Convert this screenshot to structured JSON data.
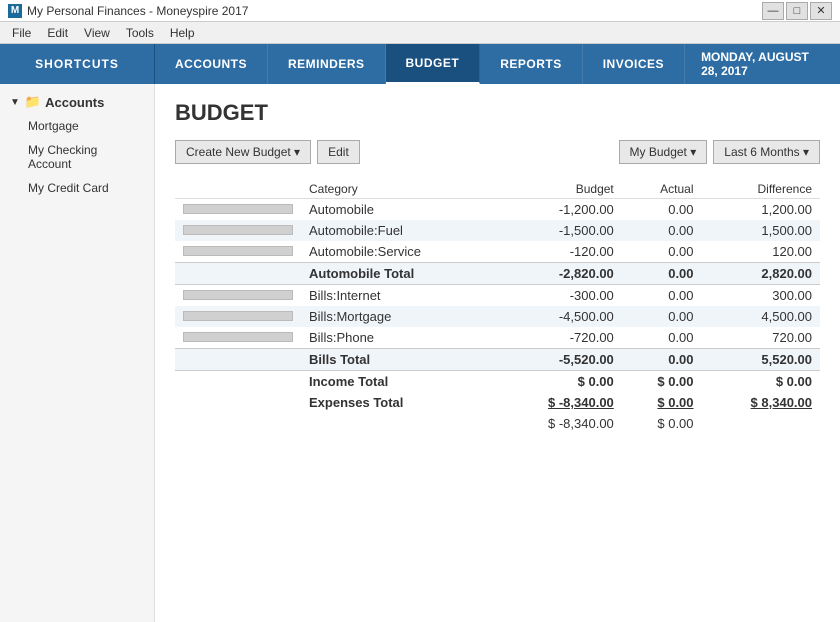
{
  "titlebar": {
    "icon": "M",
    "title": "My Personal Finances - Moneyspire 2017",
    "min_btn": "—",
    "max_btn": "□",
    "close_btn": "✕"
  },
  "menubar": {
    "items": [
      "File",
      "Edit",
      "View",
      "Tools",
      "Help"
    ]
  },
  "topnav": {
    "shortcuts_label": "SHORTCUTS",
    "tabs": [
      {
        "label": "ACCOUNTS",
        "active": false
      },
      {
        "label": "REMINDERS",
        "active": false
      },
      {
        "label": "BUDGET",
        "active": true
      },
      {
        "label": "REPORTS",
        "active": false
      },
      {
        "label": "INVOICES",
        "active": false
      }
    ],
    "date": "MONDAY, AUGUST 28, 2017"
  },
  "sidebar": {
    "accounts_label": "Accounts",
    "accounts": [
      {
        "name": "Mortgage"
      },
      {
        "name": "My Checking Account"
      },
      {
        "name": "My Credit Card"
      }
    ]
  },
  "content": {
    "page_title": "BUDGET",
    "toolbar": {
      "create_btn": "Create New Budget ▾",
      "edit_btn": "Edit",
      "budget_selector": "My Budget ▾",
      "period_selector": "Last 6 Months ▾"
    },
    "table": {
      "headers": {
        "category": "Category",
        "budget": "Budget",
        "actual": "Actual",
        "difference": "Difference"
      },
      "rows": [
        {
          "type": "item",
          "category": "Automobile",
          "budget": "-1,200.00",
          "actual": "0.00",
          "difference": "1,200.00",
          "diff_color": "green",
          "striped": false
        },
        {
          "type": "item",
          "category": "Automobile:Fuel",
          "budget": "-1,500.00",
          "actual": "0.00",
          "difference": "1,500.00",
          "diff_color": "green",
          "striped": true
        },
        {
          "type": "item",
          "category": "Automobile:Service",
          "budget": "-120.00",
          "actual": "0.00",
          "difference": "120.00",
          "diff_color": "green",
          "striped": false
        },
        {
          "type": "total",
          "category": "Automobile Total",
          "budget": "-2,820.00",
          "actual": "0.00",
          "difference": "2,820.00",
          "diff_color": "green",
          "striped": true
        },
        {
          "type": "item",
          "category": "Bills:Internet",
          "budget": "-300.00",
          "actual": "0.00",
          "difference": "300.00",
          "diff_color": "green",
          "striped": false
        },
        {
          "type": "item",
          "category": "Bills:Mortgage",
          "budget": "-4,500.00",
          "actual": "0.00",
          "difference": "4,500.00",
          "diff_color": "green",
          "striped": true
        },
        {
          "type": "item",
          "category": "Bills:Phone",
          "budget": "-720.00",
          "actual": "0.00",
          "difference": "720.00",
          "diff_color": "green",
          "striped": false
        },
        {
          "type": "total",
          "category": "Bills Total",
          "budget": "-5,520.00",
          "actual": "0.00",
          "difference": "5,520.00",
          "diff_color": "green",
          "striped": true
        },
        {
          "type": "grand",
          "category": "Income Total",
          "budget": "$ 0.00",
          "actual": "$ 0.00",
          "difference": "$ 0.00",
          "diff_color": "black",
          "striped": false
        },
        {
          "type": "grand",
          "category": "Expenses Total",
          "budget": "$ -8,340.00",
          "actual": "$ 0.00",
          "difference": "$ 8,340.00",
          "diff_color": "green",
          "striped": false
        },
        {
          "type": "summary",
          "col1": "$ -8,340.00",
          "col2": "$ 0.00",
          "striped": false
        }
      ]
    }
  }
}
